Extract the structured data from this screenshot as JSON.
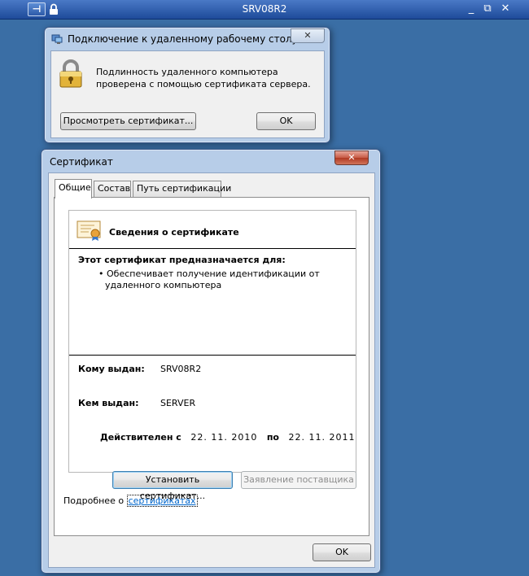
{
  "rdp_bar": {
    "title": "SRV08R2",
    "pin_label": "⊣",
    "min_label": "_",
    "max_label": "⧉",
    "close_label": "✕"
  },
  "rdc_dialog": {
    "title": "Подключение к удаленному рабочему столу",
    "close_label": "✕",
    "message": "Подлинность удаленного компьютера проверена с помощью сертификата сервера.",
    "view_cert_button": "Просмотреть сертификат...",
    "ok_button": "OK"
  },
  "cert_dialog": {
    "title": "Сертификат",
    "close_label": "✕",
    "tabs": [
      {
        "label": "Общие"
      },
      {
        "label": "Состав"
      },
      {
        "label": "Путь сертификации"
      }
    ],
    "info_heading": "Сведения о сертификате",
    "purpose_heading": "Этот сертификат предназначается для:",
    "purpose_items": [
      "Обеспечивает получение идентификации от удаленного компьютера"
    ],
    "issued_to_label": "Кому выдан:",
    "issued_to_value": "SRV08R2",
    "issued_by_label": "Кем выдан:",
    "issued_by_value": "SERVER",
    "valid_from_label": "Действителен с",
    "valid_from": "22. 11. 2010",
    "valid_to_label": "по",
    "valid_to": "22. 11. 2011",
    "install_button": "Установить сертификат...",
    "issuer_statement_button": "Заявление поставщика",
    "learn_more_prefix": "Подробнее о ",
    "learn_more_link": "сертификатах",
    "ok_button": "OK"
  },
  "colors": {
    "desktop": "#3a6ea5",
    "link": "#0066cc"
  }
}
